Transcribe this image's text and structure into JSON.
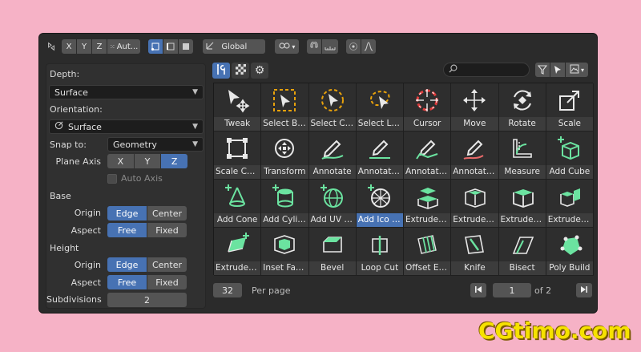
{
  "header": {
    "axis_buttons": [
      "X",
      "Y",
      "Z"
    ],
    "auto_label": "Aut...",
    "orientation_label": "Global"
  },
  "settings": {
    "depth_label": "Depth:",
    "depth_value": "Surface",
    "orientation_label": "Orientation:",
    "orientation_value": "Surface",
    "snap_to_label": "Snap to:",
    "snap_to_value": "Geometry",
    "plane_axis_label": "Plane Axis",
    "plane_axis_options": [
      "X",
      "Y",
      "Z"
    ],
    "plane_axis_selected": "Z",
    "auto_axis_label": "Auto Axis",
    "base_label": "Base",
    "height_label": "Height",
    "origin_label": "Origin",
    "aspect_label": "Aspect",
    "origin_options": [
      "Edge",
      "Center"
    ],
    "aspect_options": [
      "Free",
      "Fixed"
    ],
    "subdivisions_label": "Subdivisions",
    "subdivisions_value": "2"
  },
  "tools": [
    {
      "label": "Tweak",
      "icon": "tweak-icon"
    },
    {
      "label": "Select Box",
      "icon": "select-box-icon"
    },
    {
      "label": "Select Cir...",
      "icon": "select-circle-icon"
    },
    {
      "label": "Select Las...",
      "icon": "select-lasso-icon"
    },
    {
      "label": "Cursor",
      "icon": "cursor-icon"
    },
    {
      "label": "Move",
      "icon": "move-icon"
    },
    {
      "label": "Rotate",
      "icon": "rotate-icon"
    },
    {
      "label": "Scale",
      "icon": "scale-icon"
    },
    {
      "label": "Scale Ca...",
      "icon": "scale-cage-icon"
    },
    {
      "label": "Transform",
      "icon": "transform-icon"
    },
    {
      "label": "Annotate",
      "icon": "annotate-icon"
    },
    {
      "label": "Annotate ...",
      "icon": "annotate-line-icon"
    },
    {
      "label": "Annotate ...",
      "icon": "annotate-polygon-icon"
    },
    {
      "label": "Annotate ...",
      "icon": "annotate-eraser-icon"
    },
    {
      "label": "Measure",
      "icon": "measure-icon"
    },
    {
      "label": "Add Cube",
      "icon": "add-cube-icon"
    },
    {
      "label": "Add Cone",
      "icon": "add-cone-icon"
    },
    {
      "label": "Add Cylin...",
      "icon": "add-cylinder-icon"
    },
    {
      "label": "Add UV S...",
      "icon": "add-uv-sphere-icon"
    },
    {
      "label": "Add Ico S...",
      "icon": "add-ico-sphere-icon"
    },
    {
      "label": "Extrude R...",
      "icon": "extrude-region-icon"
    },
    {
      "label": "Extrude M...",
      "icon": "extrude-manifold-icon"
    },
    {
      "label": "Extrude Al...",
      "icon": "extrude-along-normals-icon"
    },
    {
      "label": "Extrude I...",
      "icon": "extrude-individual-icon"
    },
    {
      "label": "Extrude t...",
      "icon": "extrude-to-cursor-icon"
    },
    {
      "label": "Inset Faces",
      "icon": "inset-faces-icon"
    },
    {
      "label": "Bevel",
      "icon": "bevel-icon"
    },
    {
      "label": "Loop Cut",
      "icon": "loop-cut-icon"
    },
    {
      "label": "Offset Edg...",
      "icon": "offset-edge-icon"
    },
    {
      "label": "Knife",
      "icon": "knife-icon"
    },
    {
      "label": "Bisect",
      "icon": "bisect-icon"
    },
    {
      "label": "Poly Build",
      "icon": "poly-build-icon"
    }
  ],
  "selected_tool_index": 19,
  "footer": {
    "per_page_count": "32",
    "per_page_label": "Per page",
    "current_page": "1",
    "page_total": "of 2"
  },
  "watermark": "CGtimo.com",
  "colors": {
    "accent": "#4772b3",
    "mesh_green": "#6be3a0",
    "dashed_orange": "#e8a20c",
    "cursor_red": "#e03c3c"
  }
}
